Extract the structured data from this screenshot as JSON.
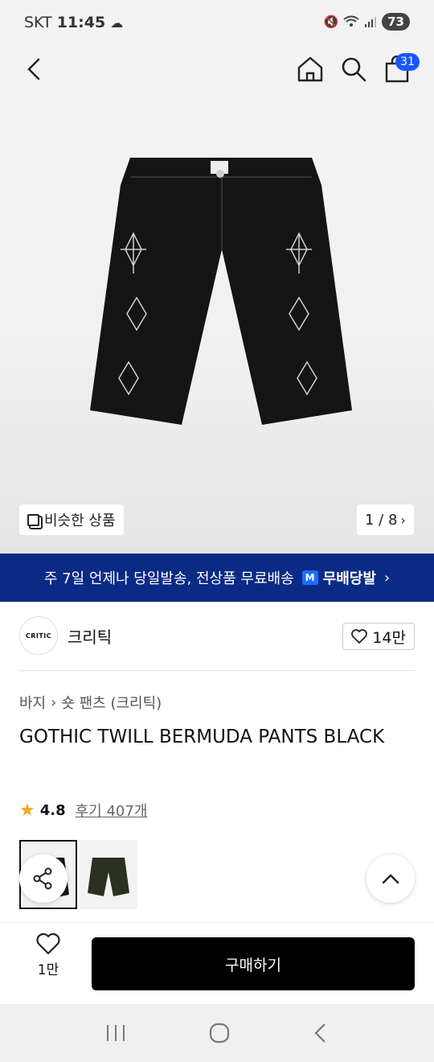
{
  "status": {
    "carrier": "SKT",
    "time": "11:45",
    "battery": "73"
  },
  "header": {
    "cart_count": "31"
  },
  "gallery": {
    "similar_label": "비슷한 상품",
    "pager": "1 / 8"
  },
  "banner": {
    "text": "주 7일 언제나 당일발송, 전상품 무료배송",
    "mbadge": "M",
    "brand": "무배당발"
  },
  "brand": {
    "logo_text": "CRITIC",
    "name": "크리틱",
    "likes": "14만"
  },
  "breadcrumb": {
    "level1": "바지",
    "level2": "숏 팬츠 (크리틱)"
  },
  "product": {
    "title": "GOTHIC TWILL BERMUDA PANTS BLACK",
    "rating": "4.8",
    "reviews": "후기 407개"
  },
  "bottom": {
    "wish_count": "1만",
    "buy_label": "구매하기"
  },
  "colors": {
    "banner_bg": "#0b2a86",
    "badge": "#1a56ff",
    "star": "#f5a623"
  }
}
